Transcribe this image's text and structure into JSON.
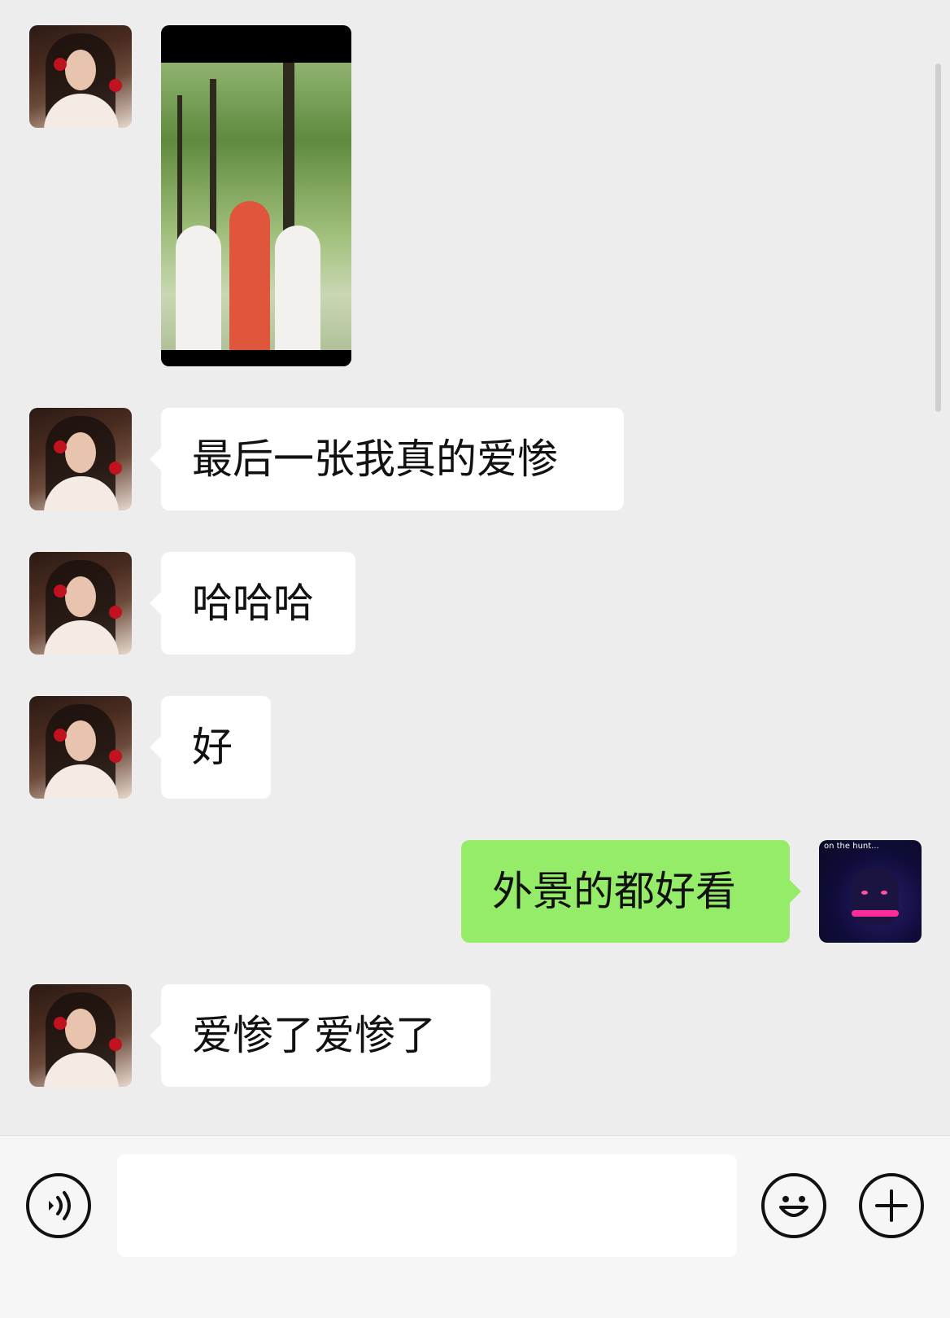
{
  "messages": [
    {
      "side": "left",
      "type": "image",
      "alt": ""
    },
    {
      "side": "left",
      "type": "text",
      "text": "最后一张我真的爱惨"
    },
    {
      "side": "left",
      "type": "text",
      "text": "哈哈哈"
    },
    {
      "side": "left",
      "type": "text",
      "text": "好"
    },
    {
      "side": "right",
      "type": "text",
      "text": "外景的都好看"
    },
    {
      "side": "left",
      "type": "text",
      "text": "爱惨了爱惨了"
    }
  ],
  "my_avatar_caption": "on the hunt...",
  "input": {
    "value": "",
    "placeholder": ""
  },
  "icons": {
    "voice": "voice-icon",
    "emoji": "emoji-icon",
    "more": "plus-icon"
  },
  "colors": {
    "background": "#ededed",
    "incoming_bubble": "#ffffff",
    "outgoing_bubble": "#95ec69",
    "input_bar": "#f6f6f6"
  }
}
